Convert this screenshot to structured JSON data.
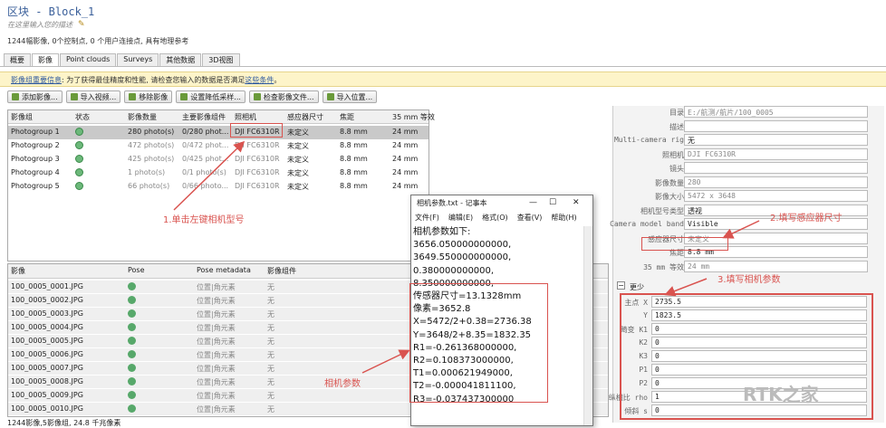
{
  "header": {
    "title": "区块 - Block_1",
    "subtitle": "在这里输入您的描述",
    "stats": "1244幅影像, 0个控制点, 0 个用户连接点, 具有地理参考"
  },
  "tabs": [
    "概要",
    "影像",
    "Point clouds",
    "Surveys",
    "其他数据",
    "3D视图"
  ],
  "warning": {
    "head": "影像组重要信息",
    "body": ": 为了获得最佳精度和性能, 请检查您输入的数据是否满足",
    "link": "这些条件",
    "tail": "。"
  },
  "toolbar": [
    "添加影像...",
    "导入视频...",
    "移除影像",
    "设置降低采样...",
    "检查影像文件...",
    "导入位置..."
  ],
  "groups": {
    "headers": [
      "影像组",
      "状态",
      "影像数量",
      "主要影像组件",
      "照相机",
      "感应器尺寸",
      "焦距",
      "35 mm 等效"
    ],
    "rows": [
      [
        "Photogroup 1",
        "280 photo(s)",
        "0/280 phot...",
        "DJI FC6310R",
        "未定义",
        "8.8 mm",
        "24 mm"
      ],
      [
        "Photogroup 2",
        "472 photo(s)",
        "0/472 phot...",
        "DJI FC6310R",
        "未定义",
        "8.8 mm",
        "24 mm"
      ],
      [
        "Photogroup 3",
        "425 photo(s)",
        "0/425 phot...",
        "DJI FC6310R",
        "未定义",
        "8.8 mm",
        "24 mm"
      ],
      [
        "Photogroup 4",
        "1 photo(s)",
        "0/1 photo(s)",
        "DJI FC6310R",
        "未定义",
        "8.8 mm",
        "24 mm"
      ],
      [
        "Photogroup 5",
        "66 photo(s)",
        "0/66 photo...",
        "DJI FC6310R",
        "未定义",
        "8.8 mm",
        "24 mm"
      ]
    ]
  },
  "photos": {
    "headers": [
      "影像",
      "Pose",
      "Pose metadata",
      "影像组件"
    ],
    "rows": [
      [
        "100_0005_0001.JPG",
        "Complete",
        "位置|角元素",
        "无"
      ],
      [
        "100_0005_0002.JPG",
        "Complete",
        "位置|角元素",
        "无"
      ],
      [
        "100_0005_0003.JPG",
        "Complete",
        "位置|角元素",
        "无"
      ],
      [
        "100_0005_0004.JPG",
        "Complete",
        "位置|角元素",
        "无"
      ],
      [
        "100_0005_0005.JPG",
        "Complete",
        "位置|角元素",
        "无"
      ],
      [
        "100_0005_0006.JPG",
        "Complete",
        "位置|角元素",
        "无"
      ],
      [
        "100_0005_0007.JPG",
        "Complete",
        "位置|角元素",
        "无"
      ],
      [
        "100_0005_0008.JPG",
        "Complete",
        "位置|角元素",
        "无"
      ],
      [
        "100_0005_0009.JPG",
        "Complete",
        "位置|角元素",
        "无"
      ],
      [
        "100_0005_0010.JPG",
        "Complete",
        "位置|角元素",
        "无"
      ]
    ]
  },
  "footer": "1244影像,5影像组, 24.8 千兆像素",
  "props": [
    [
      "目录",
      "E:/航测/航片/100_0005"
    ],
    [
      "描述",
      ""
    ],
    [
      "Multi-camera rig",
      "无"
    ],
    [
      "照相机",
      "DJI FC6310R"
    ],
    [
      "镜头",
      ""
    ],
    [
      "影像数量",
      "280"
    ],
    [
      "影像大小",
      "5472 x 3648"
    ],
    [
      "相机型号类型",
      "透视"
    ],
    [
      "Camera model band",
      "Visible"
    ],
    [
      "感应器尺寸",
      "未定义"
    ],
    [
      "焦距",
      "8.8 mm"
    ],
    [
      "35 mm 等效",
      "24 mm"
    ]
  ],
  "less_label": "更少",
  "params": [
    [
      "主点 X",
      "2735.5"
    ],
    [
      "Y",
      "1823.5"
    ],
    [
      "畸变 K1",
      "0"
    ],
    [
      "K2",
      "0"
    ],
    [
      "K3",
      "0"
    ],
    [
      "P1",
      "0"
    ],
    [
      "P2",
      "0"
    ],
    [
      "纵横比 rho",
      "1"
    ],
    [
      "倾斜 s",
      "0"
    ]
  ],
  "notepad": {
    "title": "相机参数.txt - 记事本",
    "menu": [
      "文件(F)",
      "编辑(E)",
      "格式(O)",
      "查看(V)",
      "帮助(H)"
    ],
    "lines": [
      "相机参数如下:",
      "3656.050000000000,",
      "3649.550000000000,",
      "0.380000000000,",
      "8.350000000000,",
      "传感器尺寸=13.1328mm",
      "像素=3652.8",
      "X=5472/2+0.38=2736.38",
      "Y=3648/2+8.35=1832.35",
      "R1=-0.261368000000,",
      "R2=0.108373000000,",
      "T1=0.000621949000,",
      "T2=-0.000041811100,",
      "R3=-0.037437300000"
    ]
  },
  "annotations": {
    "a1": "1.单击左键相机型号",
    "a2": "2.填写感应器尺寸",
    "a3": "3.填写相机参数",
    "a4": "相机参数"
  },
  "watermark": "RTK之家",
  "colors": {
    "accent": "#d9534f",
    "warn_bg": "#fdf4c9",
    "link": "#2f5aa0"
  }
}
